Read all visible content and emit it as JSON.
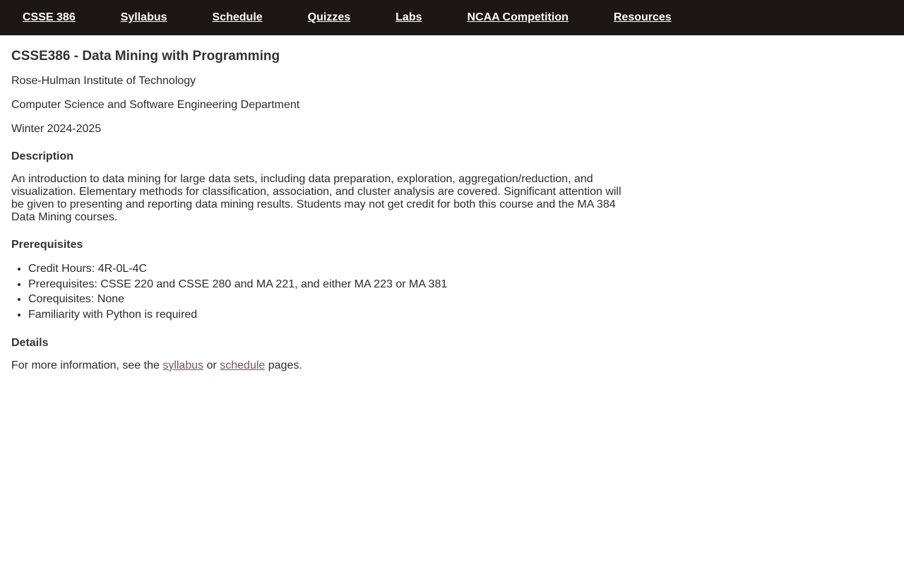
{
  "nav": {
    "items": [
      "CSSE 386",
      "Syllabus",
      "Schedule",
      "Quizzes",
      "Labs",
      "NCAA Competition",
      "Resources"
    ]
  },
  "page": {
    "title": "CSSE386 - Data Mining with Programming",
    "institution": "Rose-Hulman Institute of Technology",
    "department": "Computer Science and Software Engineering Department",
    "term": "Winter 2024-2025"
  },
  "description": {
    "heading": "Description",
    "text": "An introduction to data mining for large data sets, including data preparation, exploration, aggregation/reduction, and visualization. Elementary methods for classification, association, and cluster analysis are covered. Significant attention will be given to presenting and reporting data mining results. Students may not get credit for both this course and the MA 384 Data Mining courses."
  },
  "prerequisites": {
    "heading": "Prerequisites",
    "items": [
      "Credit Hours: 4R-0L-4C",
      "Prerequisites: CSSE 220 and CSSE 280 and MA 221, and either MA 223 or MA 381",
      "Corequisites: None",
      "Familiarity with Python is required"
    ]
  },
  "details": {
    "heading": "Details",
    "text_before": "For more information, see the ",
    "syllabus_link": "syllabus",
    "text_middle": " or ",
    "schedule_link": "schedule",
    "text_after": " pages."
  },
  "colors": {
    "nav_background": "#1c1616",
    "nav_text": "#ffffff",
    "link": "#7a5656"
  }
}
